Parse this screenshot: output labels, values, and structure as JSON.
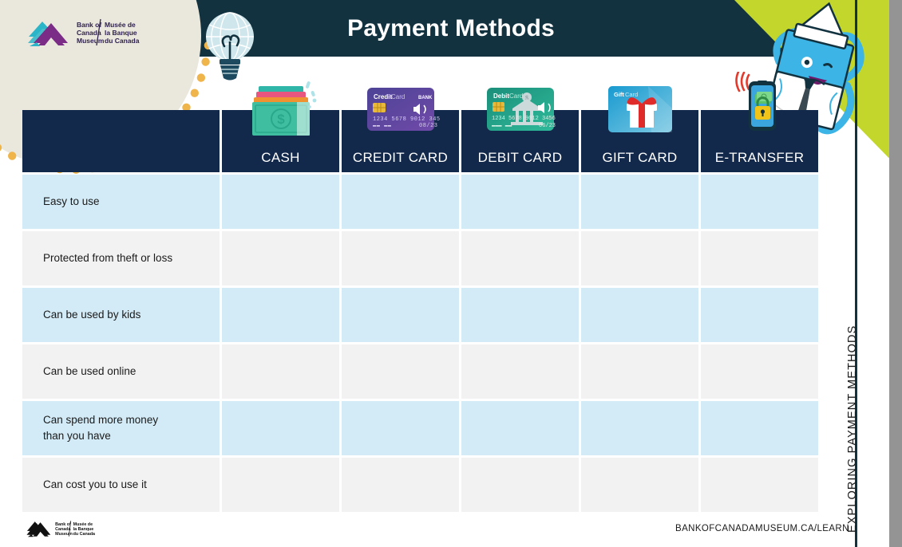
{
  "header": {
    "title": "Payment Methods",
    "band_color": "#123240",
    "logo": {
      "name": "bank-of-canada-museum-logo",
      "line1_en": "Bank of",
      "line2_en": "Canada",
      "line3_en": "Museum",
      "line1_fr": "Musée de",
      "line2_fr": "la Banque",
      "line3_fr": "du Canada"
    },
    "bulb_icon": "lightbulb-globe-icon",
    "mascot": "bank-note-mascot",
    "accent_green": "#c3d62b",
    "cream": "#eae7dc",
    "dot_color": "#efb44a"
  },
  "table": {
    "header_bg": "#13294b",
    "row_blue": "#d2ebf7",
    "row_gray": "#f2f2f2",
    "corner_label": "",
    "columns": [
      {
        "label": "CASH",
        "icon": "cash-stack-icon"
      },
      {
        "label": "CREDIT CARD",
        "icon": "credit-card-icon"
      },
      {
        "label": "DEBIT CARD",
        "icon": "debit-card-icon"
      },
      {
        "label": "GIFT CARD",
        "icon": "gift-card-icon"
      },
      {
        "label": "E-TRANSFER",
        "icon": "phone-lock-icon"
      }
    ],
    "rows": [
      {
        "label": "Easy to use",
        "shade": "blue"
      },
      {
        "label": "Protected from theft or loss",
        "shade": "gray"
      },
      {
        "label": "Can be used by kids",
        "shade": "blue"
      },
      {
        "label": "Can be used online",
        "shade": "gray"
      },
      {
        "label": "Can spend more money\nthan you have",
        "shade": "blue"
      },
      {
        "label": "Can cost you to use it",
        "shade": "gray"
      }
    ]
  },
  "footer": {
    "url": "BANKOFCANADAMUSEUM.CA/LEARN",
    "logo": "bank-of-canada-museum-logo-mono"
  },
  "side_rail": {
    "text": "EXPLORING PAYMENT METHODS"
  }
}
